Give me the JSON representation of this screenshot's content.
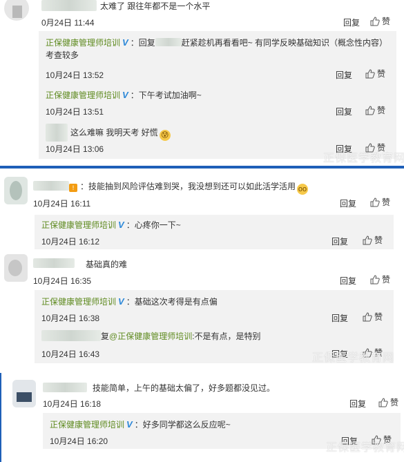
{
  "actions": {
    "reply": "回复",
    "like": "赞"
  },
  "official_name": "正保健康管理师培训",
  "watermark": "正保医学教育网",
  "block1": {
    "top_comment": {
      "text": "太难了 跟往年都不是一个水平",
      "time": "0月24日 11:44"
    },
    "replies": [
      {
        "author": "正保健康管理师培训",
        "prefix": "：回复",
        "text": "赶紧趁机再看看吧~ 有同学反映基础知识（概念性内容）考查较多",
        "time": "10月24日 13:52"
      },
      {
        "author": "正保健康管理师培训",
        "prefix": "：",
        "text": "下午考试加油啊~",
        "time": "10月24日 13:51"
      },
      {
        "author": "",
        "prefix": "",
        "text": "这么难嘛 我明天考 好慌",
        "time": "10月24日 13:06"
      }
    ]
  },
  "block2": {
    "top_comment": {
      "text": "：技能抽到风险评估难到哭，我没想到还可以如此活学活用",
      "time": "10月24日 16:11"
    },
    "replies": [
      {
        "author": "正保健康管理师培训",
        "prefix": "：",
        "text": "心疼你一下~",
        "time": "10月24日 16:12"
      }
    ]
  },
  "block3": {
    "top_comment": {
      "text": "基础真的难",
      "time": "10月24日 16:35"
    },
    "replies": [
      {
        "author": "正保健康管理师培训",
        "prefix": "：",
        "text": "基础这次考得是有点偏",
        "time": "10月24日 16:38"
      },
      {
        "author": "",
        "prefix": "复",
        "mention": "@正保健康管理师培训",
        "text": ":不是有点，是特别",
        "time": "10月24日 16:43"
      }
    ]
  },
  "block4": {
    "top_comment": {
      "text": "技能简单，上午的基础太偏了，好多题都没见过。",
      "time": "10月24日 16:18"
    },
    "replies": [
      {
        "author": "正保健康管理师培训",
        "prefix": "：",
        "text": "好多同学都这么反应呢~",
        "time": "10月24日 16:20"
      }
    ]
  },
  "colors": {
    "separator": "#1e5fb8",
    "official": "#5e8a1f",
    "verified": "#2b87d8",
    "reply_bg": "#f2f2f2"
  }
}
